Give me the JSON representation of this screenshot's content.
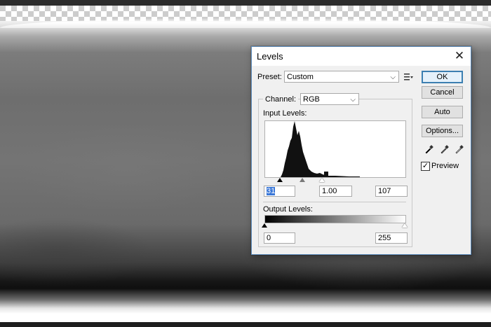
{
  "dialog": {
    "title": "Levels",
    "preset": {
      "label": "Preset:",
      "value": "Custom"
    },
    "channel": {
      "label": "Channel:",
      "value": "RGB"
    },
    "input_levels": {
      "label": "Input Levels:",
      "black": "31",
      "gamma": "1.00",
      "white": "107"
    },
    "output_levels": {
      "label": "Output Levels:",
      "black": "0",
      "white": "255"
    },
    "buttons": {
      "ok": "OK",
      "cancel": "Cancel",
      "auto": "Auto",
      "options": "Options..."
    },
    "preview": {
      "label": "Preview",
      "checked": true
    },
    "accent_color": "#3c7fb1",
    "icons": {
      "close": "close-icon",
      "preset_options": "preset-options-icon",
      "black_eyedropper": "black-eyedropper-icon",
      "gray_eyedropper": "gray-eyedropper-icon",
      "white_eyedropper": "white-eyedropper-icon"
    }
  }
}
